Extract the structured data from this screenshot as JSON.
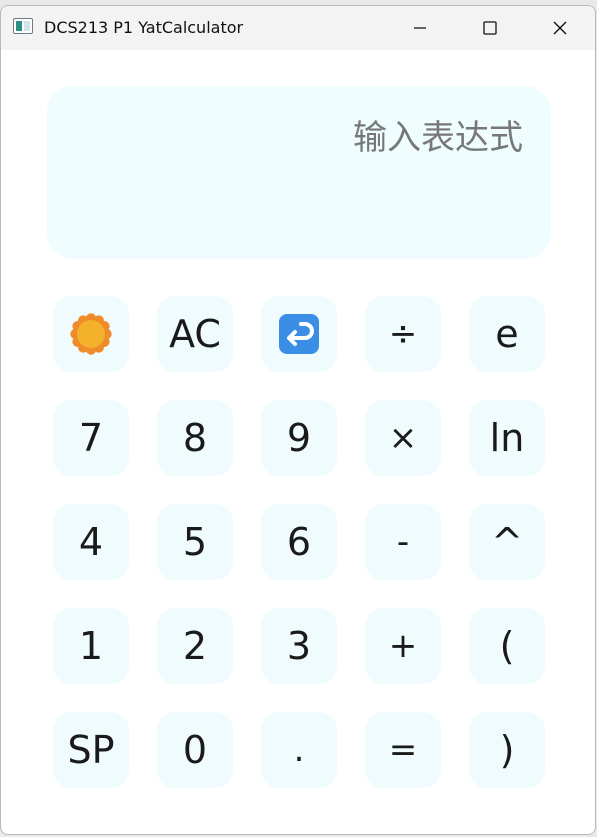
{
  "window": {
    "title": "DCS213 P1 YatCalculator",
    "icons": {
      "app": "window-app-icon",
      "minimize": "minimize-icon",
      "maximize": "maximize-icon",
      "close": "close-icon"
    }
  },
  "display": {
    "placeholder": "输入表达式"
  },
  "keys": [
    [
      {
        "name": "theme-button",
        "icon": "sun-icon",
        "label": ""
      },
      {
        "name": "clear-button",
        "label": "AC"
      },
      {
        "name": "backspace-button",
        "icon": "return-arrow-icon",
        "label": ""
      },
      {
        "name": "divide-button",
        "label": "÷",
        "op": true
      },
      {
        "name": "e-button",
        "label": "e"
      }
    ],
    [
      {
        "name": "digit-7-button",
        "label": "7"
      },
      {
        "name": "digit-8-button",
        "label": "8"
      },
      {
        "name": "digit-9-button",
        "label": "9"
      },
      {
        "name": "multiply-button",
        "label": "×",
        "op": true
      },
      {
        "name": "ln-button",
        "label": "ln"
      }
    ],
    [
      {
        "name": "digit-4-button",
        "label": "4"
      },
      {
        "name": "digit-5-button",
        "label": "5"
      },
      {
        "name": "digit-6-button",
        "label": "6"
      },
      {
        "name": "minus-button",
        "label": "-",
        "op": true
      },
      {
        "name": "power-button",
        "label": "^"
      }
    ],
    [
      {
        "name": "digit-1-button",
        "label": "1"
      },
      {
        "name": "digit-2-button",
        "label": "2"
      },
      {
        "name": "digit-3-button",
        "label": "3"
      },
      {
        "name": "plus-button",
        "label": "+",
        "op": true
      },
      {
        "name": "open-paren-button",
        "label": "("
      }
    ],
    [
      {
        "name": "sp-button",
        "label": "SP"
      },
      {
        "name": "digit-0-button",
        "label": "0"
      },
      {
        "name": "decimal-button",
        "label": ".",
        "op": true
      },
      {
        "name": "equals-button",
        "label": "=",
        "op": true
      },
      {
        "name": "close-paren-button",
        "label": ")"
      }
    ]
  ],
  "colors": {
    "key_bg": "#effbfd",
    "display_bg": "#effdff",
    "text": "#1a1a1a",
    "placeholder": "#777777"
  }
}
